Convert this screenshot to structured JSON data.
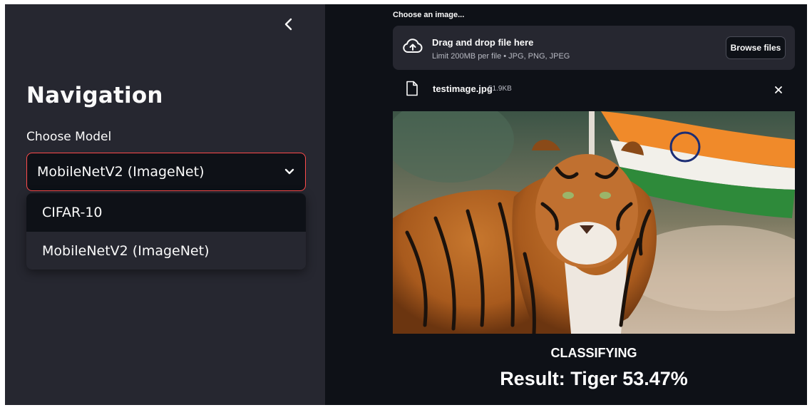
{
  "sidebar": {
    "title": "Navigation",
    "model_select": {
      "label": "Choose Model",
      "selected": "MobileNetV2 (ImageNet)",
      "options": [
        "CIFAR-10",
        "MobileNetV2 (ImageNet)"
      ]
    },
    "collapse_icon": "chevron-left-icon"
  },
  "uploader": {
    "label": "Choose an image...",
    "drop_title": "Drag and drop file here",
    "limit_text": "Limit 200MB per file • JPG, PNG, JPEG",
    "browse_label": "Browse files",
    "icon": "cloud-upload-icon"
  },
  "file": {
    "name": "testimage.jpg",
    "size": "51.9KB",
    "icon": "file-icon",
    "remove_icon": "close-icon"
  },
  "output": {
    "status": "CLASSIFYING",
    "result": "Result: Tiger 53.47%"
  },
  "colors": {
    "sidebar_bg": "#262730",
    "main_bg": "#0e1117",
    "accent": "#ff4b4b",
    "text": "#fafafa"
  }
}
